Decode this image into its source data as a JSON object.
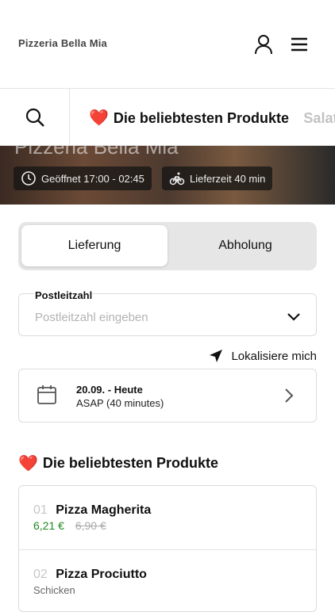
{
  "header": {
    "brand": "Pizzeria Bella Mia",
    "icons": [
      "user-icon",
      "menu-icon"
    ]
  },
  "category_bar": {
    "search_icon": "search-icon",
    "items": [
      {
        "label": "Die beliebtesten Produkte",
        "active": true,
        "emoji": "❤️"
      },
      {
        "label": "Salat",
        "active": false
      }
    ]
  },
  "hero": {
    "title": "Pizzeria Bella Mia",
    "opening_hours": "Geöffnet 17:00 - 02:45",
    "delivery_time": "Lieferzeit 40 min"
  },
  "order_mode": {
    "options": [
      "Lieferung",
      "Abholung"
    ],
    "selected": "Lieferung"
  },
  "zip_field": {
    "label": "Postleitzahl",
    "placeholder": "Postleitzahl eingeben",
    "value": ""
  },
  "locate_label": "Lokalisiere mich",
  "delivery_time_select": {
    "date": "20.09. - Heute",
    "time": "ASAP (40 minutes)"
  },
  "popular": {
    "emoji": "❤️",
    "title": "Die beliebtesten Produkte",
    "products": [
      {
        "num": "01",
        "name": "Pizza Magherita",
        "price": "6,21 €",
        "old_price": "6,90 €",
        "description": ""
      },
      {
        "num": "02",
        "name": "Pizza Prociutto",
        "price": "",
        "old_price": "",
        "description": "Schicken"
      }
    ]
  },
  "colors": {
    "price_green": "#1f8a1f",
    "heart_red": "#e12323",
    "border": "#dcdcdc"
  }
}
